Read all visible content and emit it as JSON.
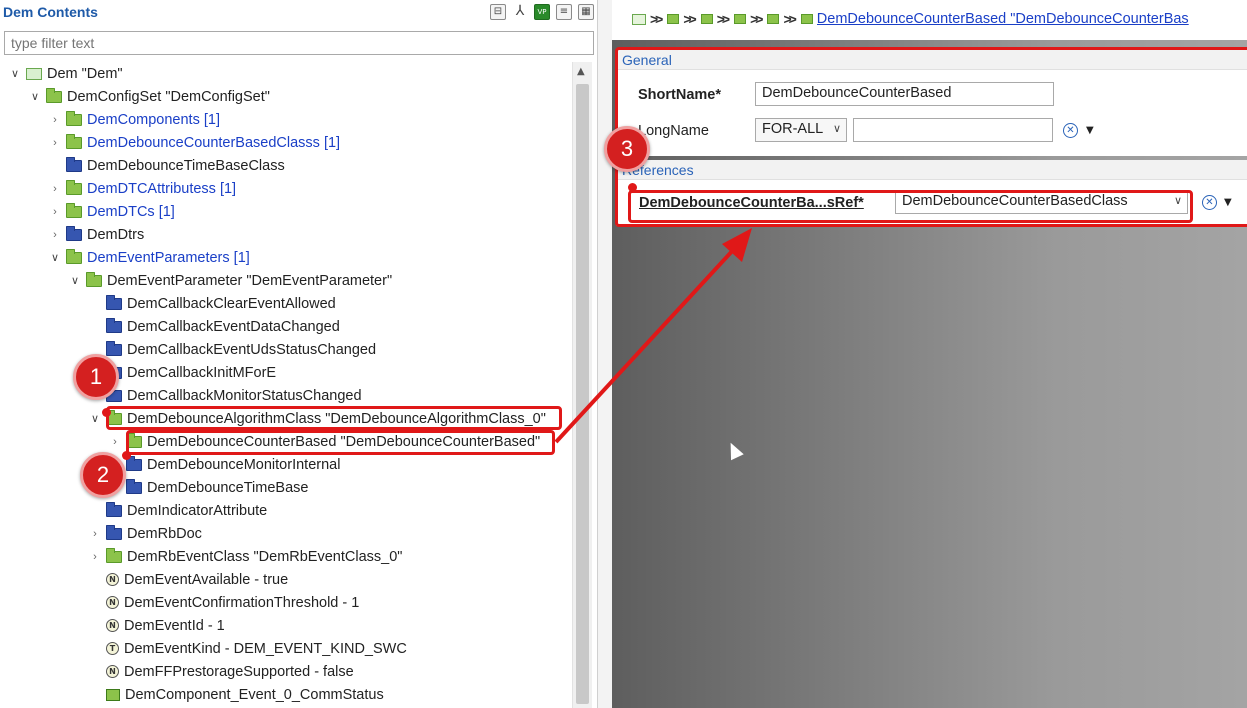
{
  "left": {
    "title": "Dem Contents",
    "filter_placeholder": "type filter text",
    "tree": [
      {
        "label": "Dem \"Dem\"",
        "depth": 0,
        "twisty": "down",
        "icon": "dem-root",
        "blue": false
      },
      {
        "label": "DemConfigSet \"DemConfigSet\"",
        "depth": 1,
        "twisty": "down",
        "icon": "green-folder",
        "blue": false
      },
      {
        "label": "DemComponents [1]",
        "depth": 2,
        "twisty": "right",
        "icon": "green-folder",
        "blue": true
      },
      {
        "label": "DemDebounceCounterBasedClasss [1]",
        "depth": 2,
        "twisty": "right",
        "icon": "green-folder",
        "blue": true
      },
      {
        "label": "DemDebounceTimeBaseClass",
        "depth": 2,
        "twisty": "",
        "icon": "blue-folder",
        "blue": false
      },
      {
        "label": "DemDTCAttributess [1]",
        "depth": 2,
        "twisty": "right",
        "icon": "green-folder",
        "blue": true
      },
      {
        "label": "DemDTCs [1]",
        "depth": 2,
        "twisty": "right",
        "icon": "green-folder",
        "blue": true
      },
      {
        "label": "DemDtrs",
        "depth": 2,
        "twisty": "right",
        "icon": "blue-folder",
        "blue": false
      },
      {
        "label": "DemEventParameters [1]",
        "depth": 2,
        "twisty": "down",
        "icon": "green-folder",
        "blue": true
      },
      {
        "label": "DemEventParameter \"DemEventParameter\"",
        "depth": 3,
        "twisty": "down",
        "icon": "green-folder",
        "blue": false
      },
      {
        "label": "DemCallbackClearEventAllowed",
        "depth": 4,
        "twisty": "",
        "icon": "blue-folder",
        "blue": false
      },
      {
        "label": "DemCallbackEventDataChanged",
        "depth": 4,
        "twisty": "",
        "icon": "blue-folder",
        "blue": false
      },
      {
        "label": "DemCallbackEventUdsStatusChanged",
        "depth": 4,
        "twisty": "",
        "icon": "blue-folder",
        "blue": false
      },
      {
        "label": "DemCallbackInitMForE",
        "depth": 4,
        "twisty": "",
        "icon": "blue-folder",
        "blue": false
      },
      {
        "label": "DemCallbackMonitorStatusChanged",
        "depth": 4,
        "twisty": "",
        "icon": "blue-folder",
        "blue": false
      },
      {
        "label": "DemDebounceAlgorithmClass \"DemDebounceAlgorithmClass_0\"",
        "depth": 4,
        "twisty": "down",
        "icon": "green-folder",
        "blue": false
      },
      {
        "label": "DemDebounceCounterBased \"DemDebounceCounterBased\"",
        "depth": 5,
        "twisty": "right",
        "icon": "green-folder",
        "blue": false
      },
      {
        "label": "DemDebounceMonitorInternal",
        "depth": 5,
        "twisty": "",
        "icon": "blue-folder",
        "blue": false
      },
      {
        "label": "DemDebounceTimeBase",
        "depth": 5,
        "twisty": "",
        "icon": "blue-folder",
        "blue": false
      },
      {
        "label": "DemIndicatorAttribute",
        "depth": 4,
        "twisty": "",
        "icon": "blue-folder",
        "blue": false
      },
      {
        "label": "DemRbDoc",
        "depth": 4,
        "twisty": "right",
        "icon": "blue-folder",
        "blue": false
      },
      {
        "label": "DemRbEventClass \"DemRbEventClass_0\"",
        "depth": 4,
        "twisty": "right",
        "icon": "green-folder",
        "blue": false
      },
      {
        "label": "DemEventAvailable - true",
        "depth": 4,
        "twisty": "",
        "icon": "param",
        "glyph": "N",
        "blue": false
      },
      {
        "label": "DemEventConfirmationThreshold - 1",
        "depth": 4,
        "twisty": "",
        "icon": "param",
        "glyph": "N",
        "blue": false
      },
      {
        "label": "DemEventId - 1",
        "depth": 4,
        "twisty": "",
        "icon": "param",
        "glyph": "N",
        "blue": false
      },
      {
        "label": "DemEventKind - DEM_EVENT_KIND_SWC",
        "depth": 4,
        "twisty": "",
        "icon": "param",
        "glyph": "T",
        "blue": false
      },
      {
        "label": "DemFFPrestorageSupported - false",
        "depth": 4,
        "twisty": "",
        "icon": "param",
        "glyph": "N",
        "blue": false
      },
      {
        "label": "DemComponent_Event_0_CommStatus",
        "depth": 4,
        "twisty": "",
        "icon": "ref",
        "blue": false
      }
    ]
  },
  "right": {
    "breadcrumb_link": "DemDebounceCounterBased \"DemDebounceCounterBas",
    "general": {
      "header": "General",
      "shortname_label": "ShortName*",
      "shortname_value": "DemDebounceCounterBased",
      "longname_label": "LongName",
      "longname_lang": "FOR-ALL",
      "longname_value": ""
    },
    "references": {
      "header": "References",
      "ref_label": "DemDebounceCounterBa...sRef*",
      "ref_value": "DemDebounceCounterBasedClass"
    }
  },
  "annotations": {
    "badge1": "1",
    "badge2": "2",
    "badge3": "3"
  },
  "colors": {
    "annotation_red": "#e01818",
    "link_blue": "#1a3fc7",
    "section_blue": "#2a63b8"
  }
}
